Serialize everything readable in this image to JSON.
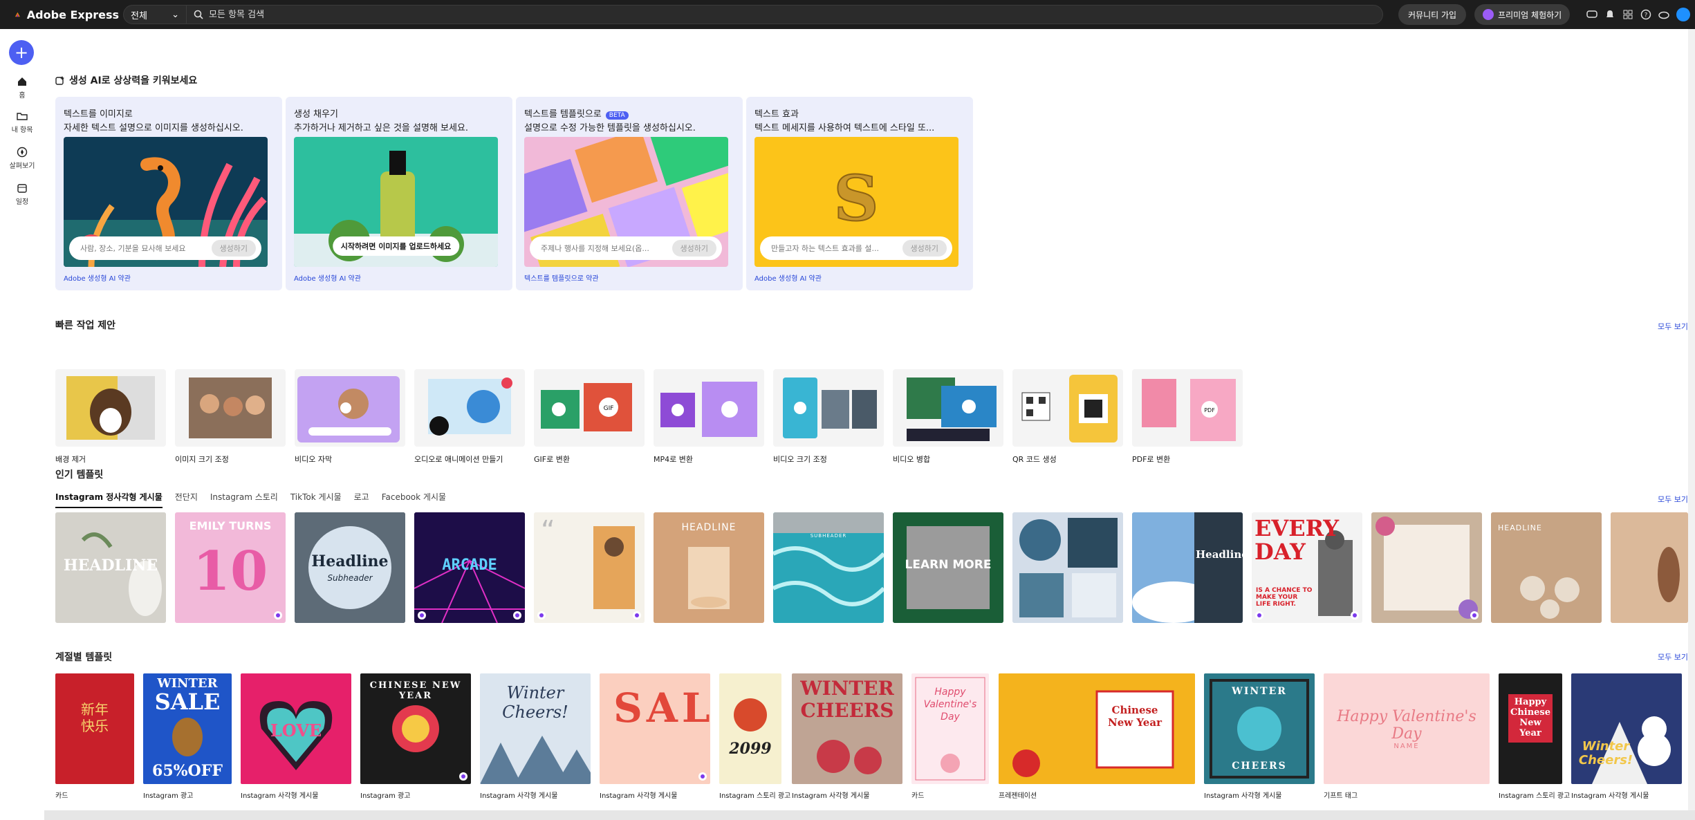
{
  "topbar": {
    "app_name": "Adobe Express",
    "scope": "전체",
    "search_placeholder": "모든 항목 검색",
    "community_button": "커뮤니티 가입",
    "premium_button": "프리미엄 체험하기"
  },
  "rail": {
    "items": [
      {
        "label": "홈"
      },
      {
        "label": "내 항목"
      },
      {
        "label": "살펴보기"
      },
      {
        "label": "일정"
      }
    ]
  },
  "ai_section": {
    "title": "생성 AI로 상상력을 키워보세요",
    "cards": [
      {
        "title": "텍스트를 이미지로",
        "desc": "자세한 텍스트 설명으로 이미지를 생성하십시오.",
        "placeholder": "사람, 장소, 기분을 묘사해 보세요",
        "button": "생성하기",
        "link": "Adobe 생성형 AI 약관"
      },
      {
        "title": "생성 채우기",
        "desc": "추가하거나 제거하고 싶은 것을 설명해 보세요.",
        "upload": "시작하려면 이미지를 업로드하세요",
        "link": "Adobe 생성형 AI 약관"
      },
      {
        "title": "텍스트를 템플릿으로",
        "beta": "BETA",
        "desc": "설명으로 수정 가능한 템플릿을 생성하십시오.",
        "placeholder": "주제나 행사를 지정해 보세요(옵...",
        "button": "생성하기",
        "link": "텍스트를 템플릿으로 약관"
      },
      {
        "title": "텍스트 효과",
        "desc": "텍스트 메세지를 사용하여 텍스트에 스타일 또...",
        "placeholder": "만들고자 하는 텍스트 효과를 설...",
        "button": "생성하기",
        "link": "Adobe 생성형 AI 약관"
      }
    ]
  },
  "quick_actions": {
    "title": "빠른 작업 제안",
    "see_all": "모두 보기",
    "items": [
      "배경 제거",
      "이미지 크기 조정",
      "비디오 자막",
      "오디오로 애니메이션 만들기",
      "GIF로 변환",
      "MP4로 변환",
      "비디오 크기 조정",
      "비디오 병합",
      "QR 코드 생성",
      "PDF로 변환"
    ]
  },
  "popular": {
    "title": "인기 템플릿",
    "see_all": "모두 보기",
    "tabs": [
      "Instagram 정사각형 게시물",
      "전단지",
      "Instagram 스토리",
      "TikTok 게시물",
      "로고",
      "Facebook 게시물"
    ],
    "texts": {
      "headline": "HEADLINE",
      "emily": "EMILY TURNS",
      "ten": "10",
      "headline2": "Headline",
      "subheader": "Subheader",
      "arcade": "ARCADE",
      "learn": "LEARN MORE",
      "everyday": "EVERY DAY",
      "everyday_sub": "IS A CHANCE TO MAKE YOUR LIFE RIGHT.",
      "subheader_caps": "SUBHEADER"
    }
  },
  "seasonal": {
    "title": "계절별 템플릿",
    "see_all": "모두 보기",
    "labels": [
      "카드",
      "Instagram 광고",
      "Instagram 사각형 게시물",
      "Instagram 광고",
      "Instagram 사각형 게시물",
      "Instagram 사각형 게시물",
      "Instagram 스토리 광고",
      "Instagram 사각형 게시물",
      "카드",
      "프레젠테이션",
      "Instagram 사각형 게시물",
      "기프트 태그",
      "Instagram 스토리 광고",
      "Instagram 사각형 게시물"
    ],
    "texts": {
      "cny": "新年快乐",
      "winter": "WINTER",
      "sale": "SALE",
      "off": "65%OFF",
      "love": "LOVE",
      "cny_en": "CHINESE NEW YEAR",
      "winter_cheers": "Winter Cheers!",
      "sale2": "SALE",
      "y2099": "2099",
      "winter_cheers_caps": "WINTER CHEERS",
      "happy_val": "Happy Valentine's Day",
      "cny_title": "Chinese New Year",
      "cheers": "CHEERS",
      "val_script": "Happy Valentine's Day",
      "name": "NAME",
      "happy_cny": "Happy Chinese New Year",
      "winter_cheers2": "Winter Cheers!"
    }
  }
}
